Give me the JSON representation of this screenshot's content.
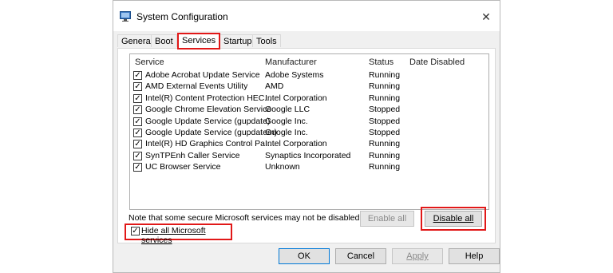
{
  "window": {
    "title": "System Configuration",
    "close_label": "✕"
  },
  "tabs": [
    {
      "label": "General"
    },
    {
      "label": "Boot"
    },
    {
      "label": "Services"
    },
    {
      "label": "Startup"
    },
    {
      "label": "Tools"
    }
  ],
  "services_table": {
    "columns": [
      "Service",
      "Manufacturer",
      "Status",
      "Date Disabled"
    ],
    "rows": [
      {
        "checked": true,
        "service": "Adobe Acrobat Update Service",
        "manufacturer": "Adobe Systems",
        "status": "Running",
        "date_disabled": ""
      },
      {
        "checked": true,
        "service": "AMD External Events Utility",
        "manufacturer": "AMD",
        "status": "Running",
        "date_disabled": ""
      },
      {
        "checked": true,
        "service": "Intel(R) Content Protection HEC...",
        "manufacturer": "Intel Corporation",
        "status": "Running",
        "date_disabled": ""
      },
      {
        "checked": true,
        "service": "Google Chrome Elevation Service",
        "manufacturer": "Google LLC",
        "status": "Stopped",
        "date_disabled": ""
      },
      {
        "checked": true,
        "service": "Google Update Service (gupdate)",
        "manufacturer": "Google Inc.",
        "status": "Stopped",
        "date_disabled": ""
      },
      {
        "checked": true,
        "service": "Google Update Service (gupdatem)",
        "manufacturer": "Google Inc.",
        "status": "Stopped",
        "date_disabled": ""
      },
      {
        "checked": true,
        "service": "Intel(R) HD Graphics Control Pa...",
        "manufacturer": "Intel Corporation",
        "status": "Running",
        "date_disabled": ""
      },
      {
        "checked": true,
        "service": "SynTPEnh Caller Service",
        "manufacturer": "Synaptics Incorporated",
        "status": "Running",
        "date_disabled": ""
      },
      {
        "checked": true,
        "service": "UC Browser Service",
        "manufacturer": "Unknown",
        "status": "Running",
        "date_disabled": ""
      }
    ]
  },
  "note": "Note that some secure Microsoft services may not be disabled.",
  "hide_ms": {
    "label": "Hide all Microsoft services",
    "checked": true
  },
  "buttons": {
    "enable_all": "Enable all",
    "disable_all": "Disable all",
    "ok": "OK",
    "cancel": "Cancel",
    "apply": "Apply",
    "help": "Help"
  },
  "colors": {
    "highlight": "#e11818",
    "accent": "#0078d7"
  }
}
